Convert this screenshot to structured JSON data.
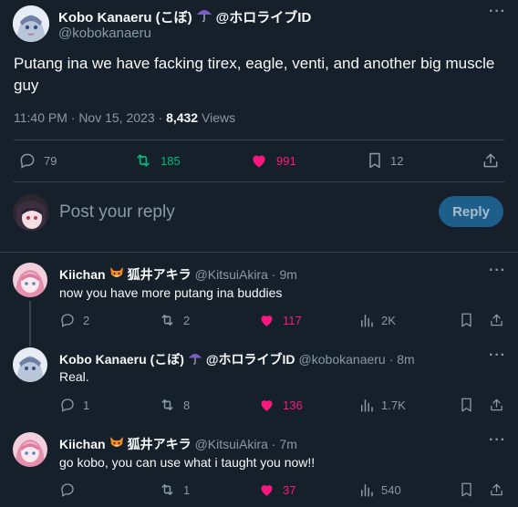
{
  "main_tweet": {
    "display_name": "Kobo Kanaeru (こぼ)",
    "name_suffix": "@ホロライブID",
    "handle": "@kobokanaeru",
    "text": "Putang ina we have facking tirex, eagle, venti, and another big muscle guy",
    "time": "11:40 PM · Nov 15, 2023 · ",
    "views_count": "8,432",
    "views_label": " Views",
    "stats": {
      "replies": "79",
      "retweets": "185",
      "likes": "991",
      "bookmarks": "12"
    }
  },
  "composer": {
    "placeholder": "Post your reply",
    "button_label": "Reply"
  },
  "replies": [
    {
      "display_name": "Kiichan",
      "name_suffix": "狐井アキラ",
      "handle": "@KitsuiAkira",
      "time": "· 9m",
      "text": "now you have more putang ina buddies",
      "replies": "2",
      "retweets": "2",
      "likes": "117",
      "views": "2K"
    },
    {
      "display_name": "Kobo Kanaeru (こぼ)",
      "name_suffix": "@ホロライブID",
      "handle": "@kobokanaeru",
      "time": "· 8m",
      "text": "Real.",
      "replies": "1",
      "retweets": "8",
      "likes": "136",
      "views": "1.7K"
    },
    {
      "display_name": "Kiichan",
      "name_suffix": "狐井アキラ",
      "handle": "@KitsuiAkira",
      "time": "· 7m",
      "text": "go kobo, you can use what i taught you now!!",
      "replies": "",
      "retweets": "1",
      "likes": "37",
      "views": "540"
    }
  ],
  "colors": {
    "background": "#15202b",
    "accent": "#1d9bf0",
    "like": "#f91880",
    "retweet": "#00ba7c"
  }
}
